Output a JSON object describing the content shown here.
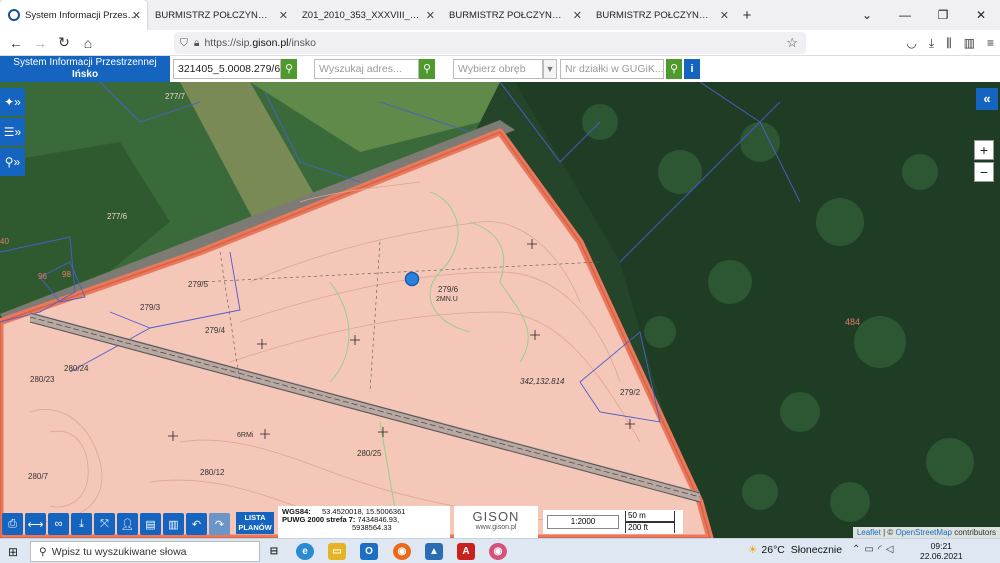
{
  "browser": {
    "tabs": [
      {
        "label": "System Informacji Przestrzennej",
        "active": true
      },
      {
        "label": "BURMISTRZ POŁCZYNA ZDROJU - U"
      },
      {
        "label": "Z01_2010_353_XXXVIII_legenda.jpg"
      },
      {
        "label": "BURMISTRZ POŁCZYNA ZDROJU - U"
      },
      {
        "label": "BURMISTRZ POŁCZYNA ZDROJU - U"
      }
    ],
    "url_prefix": "https://sip.",
    "url_host": "gison.pl",
    "url_path": "/insko"
  },
  "app": {
    "brand_line1": "System Informacji Przestrzennej",
    "brand_line2": "Ińsko",
    "parcel_search_value": "321405_5.0008.279/6 (S",
    "address_placeholder": "Wyszukaj adres...",
    "precinct_placeholder": "Wybierz obręb",
    "guguk_placeholder": "Nr działki w GUGiK..."
  },
  "map": {
    "parcel_labels": [
      "277/7",
      "277/6",
      "279/5",
      "279/3",
      "279/4",
      "279/6",
      "279/2",
      "280/24",
      "280/23",
      "280/25",
      "280/12",
      "280/7",
      "484",
      "98",
      "96",
      "40"
    ],
    "plan_labels": [
      "2MN.U",
      "6RMi"
    ],
    "elevation_label": "342,132.814",
    "attribution_link": "Leaflet",
    "attribution_sep": " | © ",
    "attribution_osm": "OpenStreetMap",
    "attribution_suffix": " contributors",
    "zoom_in": "+",
    "zoom_out": "−",
    "collapse": "«"
  },
  "footer": {
    "lista_planow_line1": "LISTA",
    "lista_planow_line2": "PLANÓW",
    "wgs_label": "WGS84:",
    "wgs_value": "53.4520018, 15.5006361",
    "puwg_label": "PUWG 2000 strefa 7:",
    "puwg_x": "7434846.93,",
    "puwg_y": "5938564.33",
    "gison_name": "GISON",
    "gison_url": "www.gison.pl",
    "scale_ratio": "1:2000",
    "scale_m": "50 m",
    "scale_ft": "200 ft"
  },
  "taskbar": {
    "search_text": "Wpisz tu wyszukiwane słowa",
    "temperature": "26°C",
    "weather": "Słonecznie",
    "time": "09:21",
    "date": "22.06.2021"
  },
  "colors": {
    "brand_blue": "#1565c0",
    "search_green": "#4e9a2e",
    "plan_fill": "#f5c7b8",
    "plan_border": "#e8795e",
    "forest": "#24452a"
  }
}
